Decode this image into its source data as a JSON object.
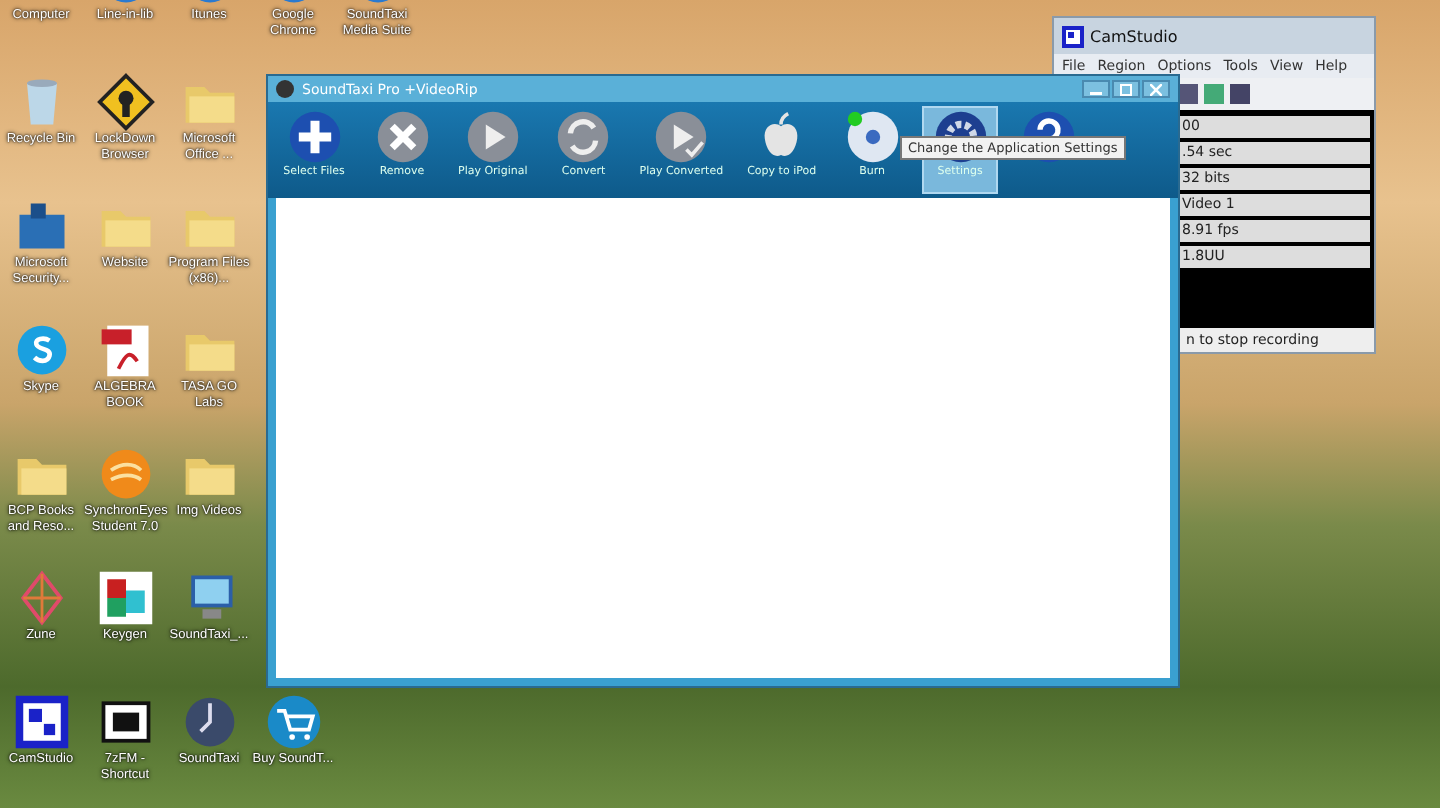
{
  "desktop": {
    "columns": [
      {
        "icons": [
          {
            "label": "Computer",
            "kind": "computer"
          },
          {
            "label": "Recycle Bin",
            "kind": "bin"
          },
          {
            "label": "Microsoft Security...",
            "kind": "shield"
          },
          {
            "label": "Skype",
            "kind": "skype"
          },
          {
            "label": "BCP Books and Reso...",
            "kind": "folder"
          },
          {
            "label": "Zune",
            "kind": "zune"
          },
          {
            "label": "CamStudio",
            "kind": "camstudio"
          }
        ]
      },
      {
        "icons": [
          {
            "label": "Line-in-lib",
            "kind": "app"
          },
          {
            "label": "LockDown Browser",
            "kind": "lock"
          },
          {
            "label": "Website",
            "kind": "folder"
          },
          {
            "label": "ALGEBRA BOOK",
            "kind": "pdf"
          },
          {
            "label": "SynchronEyes Student 7.0",
            "kind": "orb"
          },
          {
            "label": "Keygen",
            "kind": "keygen"
          },
          {
            "label": "7zFM - Shortcut",
            "kind": "zip"
          }
        ]
      },
      {
        "icons": [
          {
            "label": "Itunes",
            "kind": "app"
          },
          {
            "label": "Microsoft Office ...",
            "kind": "folder"
          },
          {
            "label": "Program Files (x86)...",
            "kind": "folder"
          },
          {
            "label": "TASA GO Labs",
            "kind": "folder"
          },
          {
            "label": "Img Videos",
            "kind": "folder"
          },
          {
            "label": "SoundTaxi_...",
            "kind": "computer"
          },
          {
            "label": "SoundTaxi",
            "kind": "clock"
          }
        ]
      },
      {
        "icons": [
          {
            "label": "Google Chrome",
            "kind": "app"
          },
          {
            "label": "Buy SoundT...",
            "kind": "cart"
          }
        ]
      },
      {
        "icons": [
          {
            "label": "SoundTaxi Media Suite",
            "kind": "app"
          }
        ]
      }
    ]
  },
  "camstudio": {
    "title": "CamStudio",
    "menu": [
      "File",
      "Region",
      "Options",
      "Tools",
      "View",
      "Help"
    ],
    "fields": [
      "00",
      ".54 sec",
      "32 bits",
      "Video 1",
      "8.91 fps",
      "1.8UU"
    ],
    "status": "n to stop recording"
  },
  "soundtaxi": {
    "title": "SoundTaxi Pro +VideoRip",
    "toolbar": [
      {
        "label": "Select Files",
        "kind": "add",
        "selected": false
      },
      {
        "label": "Remove",
        "kind": "remove",
        "selected": false
      },
      {
        "label": "Play Original",
        "kind": "play",
        "selected": false
      },
      {
        "label": "Convert",
        "kind": "convert",
        "selected": false
      },
      {
        "label": "Play Converted",
        "kind": "play-check",
        "selected": false
      },
      {
        "label": "Copy to iPod",
        "kind": "apple",
        "selected": false
      },
      {
        "label": "Burn",
        "kind": "disc",
        "selected": false
      },
      {
        "label": "Settings",
        "kind": "gear",
        "selected": true
      },
      {
        "kind": "help",
        "selected": false
      }
    ],
    "tooltip": "Change the Application Settings"
  }
}
